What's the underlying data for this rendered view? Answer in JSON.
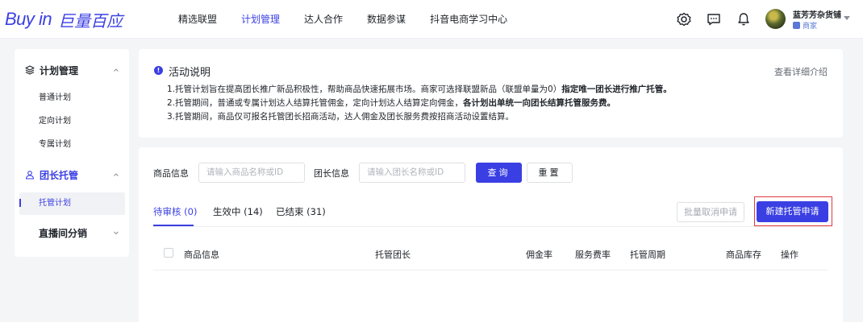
{
  "header": {
    "logo_en": "Buy in",
    "logo_cn": "巨量百应",
    "nav": [
      {
        "label": "精选联盟"
      },
      {
        "label": "计划管理"
      },
      {
        "label": "达人合作"
      },
      {
        "label": "数据参谋"
      },
      {
        "label": "抖音电商学习中心"
      }
    ],
    "active_nav": "计划管理",
    "icons": [
      "gear-icon",
      "message-icon",
      "bell-icon"
    ],
    "user": {
      "name": "蓝芳芳杂货铺",
      "role": "商家"
    }
  },
  "sidebar": {
    "groups": [
      {
        "label": "计划管理",
        "icon": "layers-icon",
        "items": [
          {
            "label": "普通计划"
          },
          {
            "label": "定向计划"
          },
          {
            "label": "专属计划"
          }
        ]
      },
      {
        "label": "团长托管",
        "icon": "user-icon",
        "items": [
          {
            "label": "托管计划"
          }
        ]
      },
      {
        "label": "直播间分销",
        "items": []
      }
    ],
    "active_item": "托管计划",
    "accent_color": "#3a3fe3"
  },
  "notice": {
    "title": "活动说明",
    "link": "查看详细介绍",
    "lines": [
      {
        "text": "1.托管计划旨在提高团长推广新品积极性，帮助商品快速拓展市场。商家可选择联盟新品（联盟单量为0）",
        "bold": "指定唯一团长进行推广托管。"
      },
      {
        "text": "2.托管期间，普通或专属计划达人结算托管佣金，定向计划达人结算定向佣金，",
        "bold": "各计划出单统一向团长结算托管服务费。"
      },
      {
        "text": "3.托管期间，商品仅可报名托管团长招商活动，达人佣金及团长服务费按招商活动设置结算。",
        "bold": ""
      }
    ]
  },
  "filters": {
    "product_label": "商品信息",
    "product_placeholder": "请输入商品名称或ID",
    "leader_label": "团长信息",
    "leader_placeholder": "请输入团长名称或ID",
    "query_button": "查询",
    "reset_button": "重置"
  },
  "tabs": [
    {
      "label": "待审核 (0)"
    },
    {
      "label": "生效中 (14)"
    },
    {
      "label": "已结束 (31)"
    }
  ],
  "actions": {
    "batch_cancel": "批量取消申请",
    "new_application": "新建托管申请"
  },
  "table": {
    "columns": [
      "商品信息",
      "托管团长",
      "佣金率",
      "服务费率",
      "托管周期",
      "商品库存",
      "操作"
    ]
  }
}
